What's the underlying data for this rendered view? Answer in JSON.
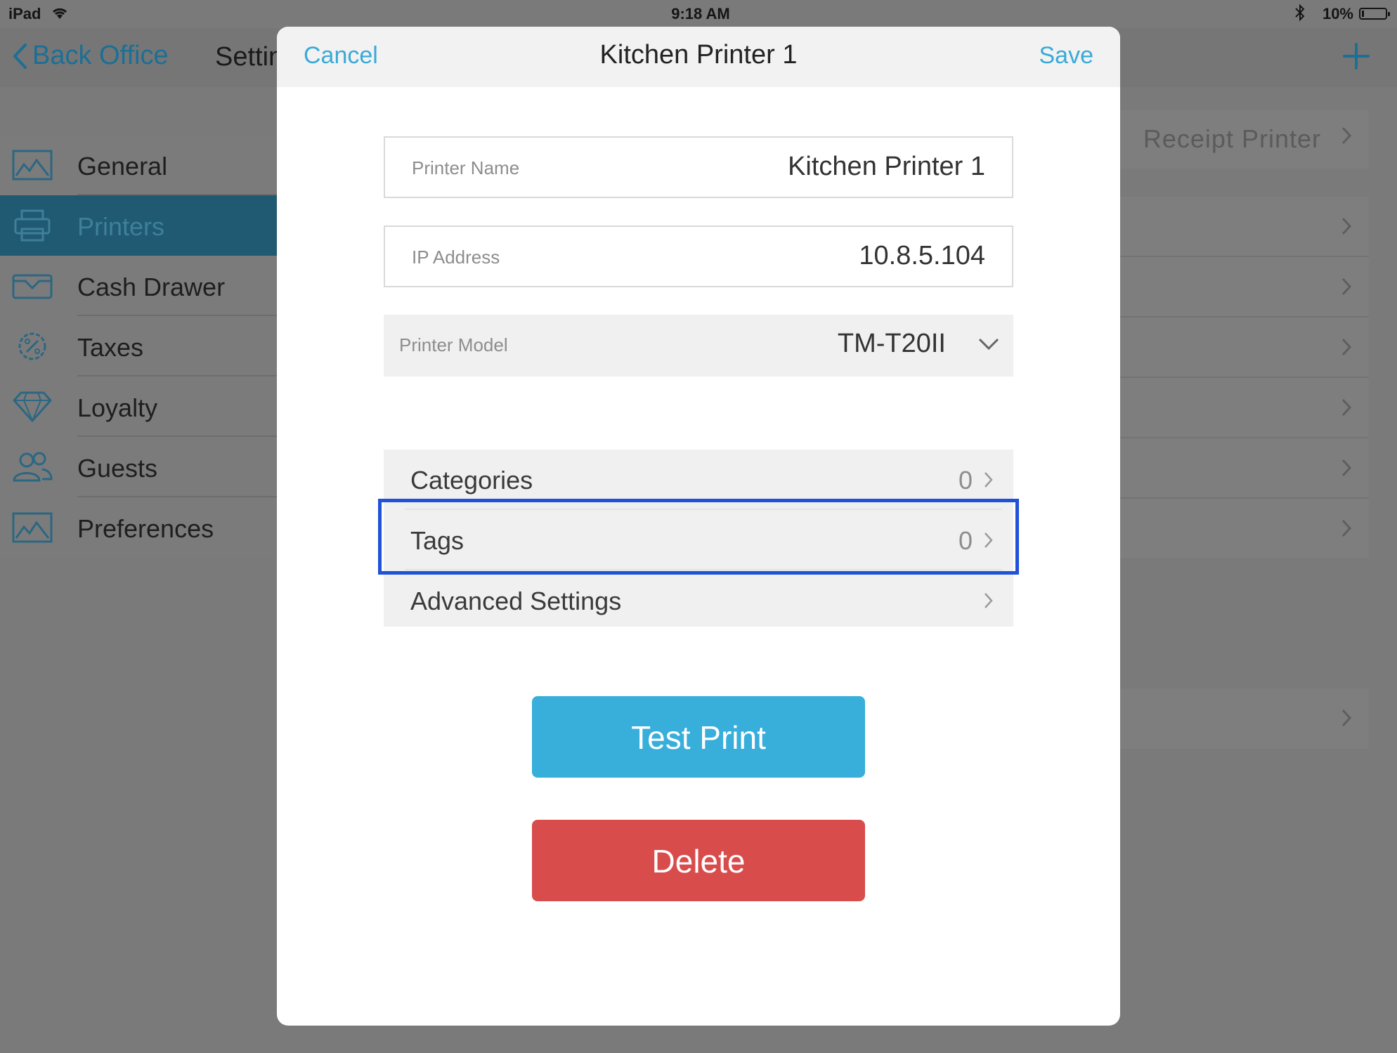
{
  "status_bar": {
    "carrier": "iPad",
    "time": "9:18 AM",
    "battery": "10%",
    "battery_level": 0.1
  },
  "nav": {
    "back_label": "Back Office",
    "title": "Settings",
    "add_icon": "plus-icon"
  },
  "sidebar": {
    "items": [
      {
        "label": "General",
        "icon": "image-icon",
        "active": false
      },
      {
        "label": "Printers",
        "icon": "printer-icon",
        "active": true
      },
      {
        "label": "Cash Drawer",
        "icon": "cash-drawer-icon",
        "active": false
      },
      {
        "label": "Taxes",
        "icon": "percent-gear-icon",
        "active": false
      },
      {
        "label": "Loyalty",
        "icon": "diamond-icon",
        "active": false
      },
      {
        "label": "Guests",
        "icon": "users-icon",
        "active": false
      },
      {
        "label": "Preferences",
        "icon": "image-icon",
        "active": false
      }
    ]
  },
  "right_panel": {
    "first_row_label": "Receipt Printer"
  },
  "modal": {
    "cancel_label": "Cancel",
    "title": "Kitchen Printer 1",
    "save_label": "Save",
    "fields": {
      "printer_name": {
        "label": "Printer Name",
        "value": "Kitchen Printer 1"
      },
      "ip_address": {
        "label": "IP Address",
        "value": "10.8.5.104"
      },
      "printer_model": {
        "label": "Printer Model",
        "value": "TM-T20II"
      }
    },
    "rows": [
      {
        "label": "Categories",
        "count": "0"
      },
      {
        "label": "Tags",
        "count": "0"
      },
      {
        "label": "Advanced Settings",
        "count": ""
      }
    ],
    "test_print_label": "Test Print",
    "delete_label": "Delete"
  },
  "colors": {
    "accent": "#39aad8",
    "test_print": "#38aedb",
    "delete": "#d94c4c",
    "highlight": "#1f51d9"
  }
}
